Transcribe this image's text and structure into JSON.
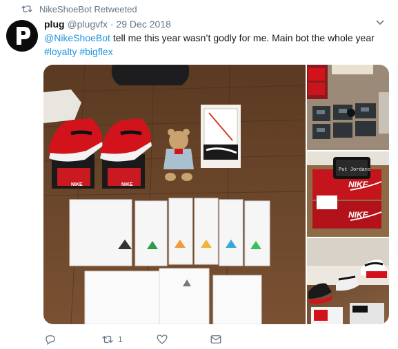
{
  "retweet": {
    "label": "NikeShoeBot Retweeted",
    "icon": "retweet-icon"
  },
  "tweet": {
    "display_name": "plug",
    "handle": "@plugvfx",
    "separator": "·",
    "date": "29 Dec 2018",
    "mention": "@NikeShoeBot",
    "text": " tell me this year wasn’t godly for me. Main bot the whole year",
    "hashtags": [
      "#loyalty",
      "#bigflex"
    ],
    "avatar_icon": "p-logo-icon",
    "caret_icon": "chevron-down-icon"
  },
  "media": {
    "photos": [
      {
        "name": "main-photo",
        "boxes": {
          "shoe_brand": "NIKE"
        },
        "shirt_count": 9
      },
      {
        "name": "photo-top-right"
      },
      {
        "name": "photo-middle-right",
        "phone_text": "Put Jordans",
        "box_brand_top": "NIKE",
        "box_brand_bottom": "NIKE"
      },
      {
        "name": "photo-bottom-right"
      }
    ]
  },
  "actions": {
    "reply": {
      "icon": "reply-icon",
      "count": ""
    },
    "retweet": {
      "icon": "retweet-icon",
      "count": "1"
    },
    "like": {
      "icon": "heart-icon",
      "count": ""
    },
    "message": {
      "icon": "envelope-icon",
      "count": ""
    }
  },
  "colors": {
    "link": "#1b95e0",
    "muted": "#657786",
    "nike_red": "#d0121b"
  }
}
